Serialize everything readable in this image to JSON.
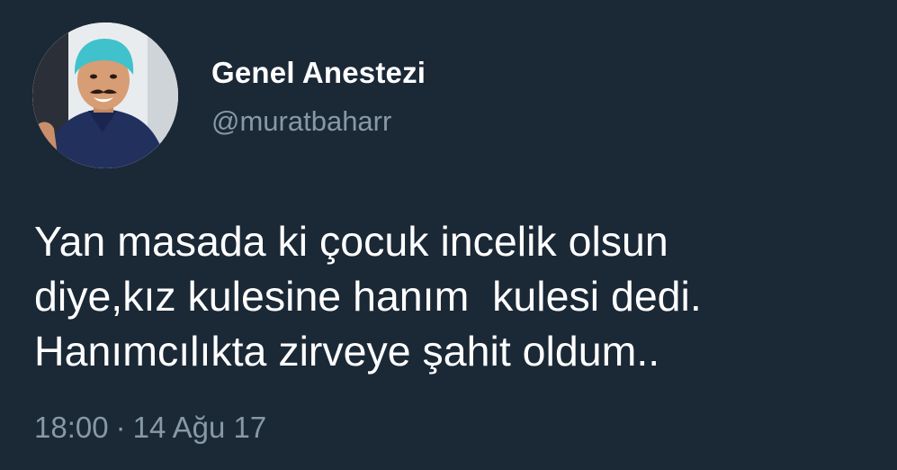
{
  "tweet": {
    "author": {
      "display_name": "Genel Anestezi",
      "handle": "@muratbaharr",
      "avatar_icon": "profile-photo"
    },
    "text_lines": [
      "Yan masada ki çocuk incelik olsun",
      "diye,kız kulesine hanım  kulesi dedi.",
      "Hanımcılıkta zirveye şahit oldum.."
    ],
    "time": "18:00",
    "separator": "·",
    "date": "14 Ağu 17"
  },
  "theme": {
    "background": "#1b2836",
    "primary_text": "#ffffff",
    "secondary_text": "#8899a6"
  }
}
